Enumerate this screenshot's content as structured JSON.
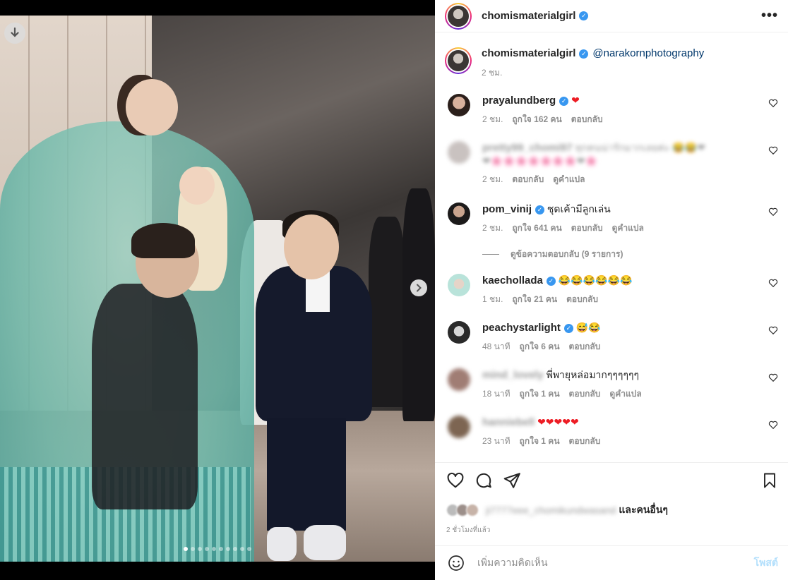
{
  "header": {
    "username": "chomismaterialgirl",
    "more_label": "•••"
  },
  "caption": {
    "username": "chomismaterialgirl",
    "mention": "@narakornphotography",
    "time": "2 ชม."
  },
  "comments": [
    {
      "user": "prayalundberg",
      "text": "",
      "time": "2 ชม.",
      "likes": "ถูกใจ 162 คน",
      "reply": "ตอบกลับ",
      "translate": ""
    },
    {
      "user": "pretty99_chomi97",
      "text": "ทุกคนน่ารักมากเลยค่ะ",
      "time": "2 ชม.",
      "likes": "",
      "reply": "ตอบกลับ",
      "translate": "ดูคำแปล"
    },
    {
      "user": "pom_vinij",
      "text": "ชุดเค้ามีลูกเล่น",
      "time": "2 ชม.",
      "likes": "ถูกใจ 641 คน",
      "reply": "ตอบกลับ",
      "translate": "ดูคำแปล"
    },
    {
      "user": "kaechollada",
      "text": "😂😂😂😂😂😂",
      "time": "1 ชม.",
      "likes": "ถูกใจ 21 คน",
      "reply": "ตอบกลับ",
      "translate": ""
    },
    {
      "user": "peachystarlight",
      "text": "😅😂",
      "time": "48 นาที",
      "likes": "ถูกใจ 6 คน",
      "reply": "ตอบกลับ",
      "translate": ""
    },
    {
      "user": "mind_lovely",
      "text": "พี่พายุหล่อมากๆๆๆๆๆๆ",
      "time": "18 นาที",
      "likes": "ถูกใจ 1 คน",
      "reply": "ตอบกลับ",
      "translate": "ดูคำแปล"
    },
    {
      "user": "hanniebell",
      "text": "",
      "time": "23 นาที",
      "likes": "ถูกใจ 1 คน",
      "reply": "ตอบกลับ",
      "translate": ""
    }
  ],
  "view_replies": "ดูข้อความตอบกลับ (9 รายการ)",
  "likes_line": {
    "blurred_user": "ji7777eee_chomikundwasand",
    "and_others": "และคนอื่นๆ"
  },
  "time_ago": "2 ชั่วโมงที่แล้ว",
  "add_comment": {
    "placeholder": "เพิ่มความคิดเห็น",
    "post_label": "โพสต์"
  },
  "carousel": {
    "count": 10,
    "active_index": 0
  },
  "icons": [
    "download-icon",
    "chevron-right-icon",
    "verified-icon",
    "more-icon",
    "heart-icon",
    "comment-icon",
    "share-icon",
    "bookmark-icon",
    "emoji-icon"
  ],
  "colors": {
    "verified": "#3897f0",
    "link": "#00376b",
    "post_disabled": "#b2dffc",
    "secondary_text": "#8e8e8e"
  }
}
